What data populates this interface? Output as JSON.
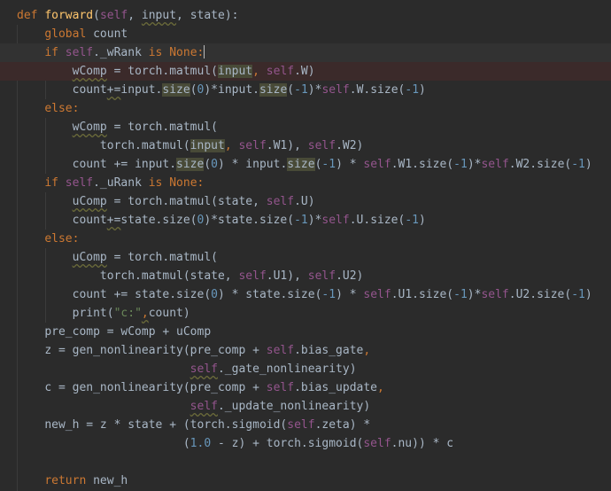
{
  "editor": {
    "language": "python",
    "theme_colors": {
      "background": "#2b2b2b",
      "text": "#a9b7c6",
      "keyword": "#cc7832",
      "function_name": "#ffc66d",
      "self": "#94558d",
      "number": "#6897bb",
      "string": "#6a8759",
      "usage_highlight": "#484a37",
      "error_line": "#3b2a2a"
    },
    "code": {
      "l1": {
        "def": "def",
        "name": "forward",
        "p1": "(",
        "self": "self",
        "p2": ", ",
        "input": "input",
        "p3": ", state):"
      },
      "l2": {
        "kw": "global",
        "rest": " count"
      },
      "l3": {
        "kw": "if",
        "self": "self",
        "attr": "._wRank ",
        "is": "is",
        "none": "None",
        "colon": ":"
      },
      "l4": {
        "lhs": "wComp",
        "mid": " = torch.matmul(",
        "input": "input",
        "comma": ", ",
        "self": "self",
        "tail": ".W)"
      },
      "l5": {
        "lhs": "count",
        "op": "+=",
        "a": "input.",
        "f1": "size",
        "b": "(",
        "n1": "0",
        "c": ")*input.",
        "f2": "size",
        "d": "(",
        "n2": "-1",
        "e": ")*",
        "self": "self",
        "f": ".W.size(",
        "n3": "-1",
        "g": ")"
      },
      "l6": {
        "kw": "else",
        "colon": ":"
      },
      "l7": {
        "lhs": "wComp",
        "mid": " = torch.matmul("
      },
      "l8": {
        "a": "torch.matmul(",
        "input": "input",
        "b": ", ",
        "s1": "self",
        "c": ".W1), ",
        "s2": "self",
        "d": ".W2)"
      },
      "l9": {
        "a": "count += input.",
        "f1": "size",
        "b": "(",
        "n1": "0",
        "c": ") * input.",
        "f2": "size",
        "d": "(",
        "n2": "-1",
        "e": ") * ",
        "s1": "self",
        "f": ".W1.size(",
        "n3": "-1",
        "g": ")*",
        "s2": "self",
        "h": ".W2.size(",
        "n4": "-1",
        "i": ")"
      },
      "l10": {
        "kw": "if",
        "self": "self",
        "attr": "._uRank ",
        "is": "is",
        "none": "None",
        "colon": ":"
      },
      "l11": {
        "lhs": "uComp",
        "mid": " = torch.matmul(state, ",
        "self": "self",
        "tail": ".U)"
      },
      "l12": {
        "lhs": "count",
        "op": "+=",
        "a": "state.size(",
        "n1": "0",
        "b": ")*state.size(",
        "n2": "-1",
        "c": ")*",
        "self": "self",
        "d": ".U.size(",
        "n3": "-1",
        "e": ")"
      },
      "l13": {
        "kw": "else",
        "colon": ":"
      },
      "l14": {
        "lhs": "uComp",
        "mid": " = torch.matmul("
      },
      "l15": {
        "a": "torch.matmul(state, ",
        "s1": "self",
        "b": ".U1), ",
        "s2": "self",
        "c": ".U2)"
      },
      "l16": {
        "a": "count += state.size(",
        "n1": "0",
        "b": ") * state.size(",
        "n2": "-1",
        "c": ") * ",
        "s1": "self",
        "d": ".U1.size(",
        "n3": "-1",
        "e": ")*",
        "s2": "self",
        "f": ".U2.size(",
        "n4": "-1",
        "g": ")"
      },
      "l17": {
        "a": "print(",
        "str": "\"c:\"",
        "comma": ",",
        "b": "count)"
      },
      "l18": {
        "text": "pre_comp = wComp + uComp"
      },
      "l19": {
        "a": "z = gen_nonlinearity(pre_comp + ",
        "self": "self",
        "b": ".bias_gate",
        "comma": ","
      },
      "l20": {
        "self": "self",
        "b": "._gate_nonlinearity)"
      },
      "l21": {
        "a": "c = gen_nonlinearity(pre_comp + ",
        "self": "self",
        "b": ".bias_update",
        "comma": ","
      },
      "l22": {
        "self": "self",
        "b": "._update_nonlinearity)"
      },
      "l23": {
        "a": "new_h = z * state + (torch.sigmoid(",
        "self": "self",
        "b": ".zeta) *"
      },
      "l24": {
        "a": "(",
        "n1": "1.0",
        "b": " - z) + torch.sigmoid(",
        "self": "self",
        "c": ".nu)) * c"
      },
      "l25": {
        "kw": "return",
        "rest": " new_h"
      }
    }
  }
}
